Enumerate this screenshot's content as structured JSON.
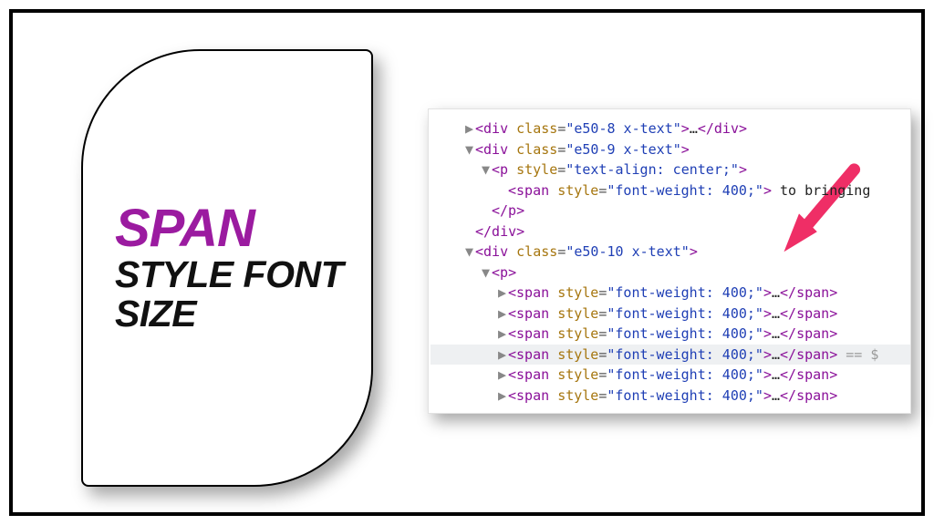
{
  "title_card": {
    "line1": "SPAN",
    "line2": "STYLE FONT",
    "line3": "SIZE"
  },
  "devtools": {
    "rows": [
      {
        "indent": 1,
        "tri": "▶",
        "open": "div",
        "attrs": [
          {
            "name": "class",
            "value": "e50-8 x-text"
          }
        ],
        "inner": "…",
        "close": "div"
      },
      {
        "indent": 1,
        "tri": "▼",
        "open": "div",
        "attrs": [
          {
            "name": "class",
            "value": "e50-9 x-text"
          }
        ]
      },
      {
        "indent": 2,
        "tri": "▼",
        "open": "p",
        "attrs": [
          {
            "name": "style",
            "value": "text-align: center;"
          }
        ]
      },
      {
        "indent": 3,
        "tri": "",
        "open": "span",
        "attrs": [
          {
            "name": "style",
            "value": "font-weight: 400;"
          }
        ],
        "trail_text": " to bringing"
      },
      {
        "indent": 2,
        "tri": "",
        "close_only": "p"
      },
      {
        "indent": 1,
        "tri": "",
        "close_only": "div"
      },
      {
        "indent": 1,
        "tri": "▼",
        "open": "div",
        "attrs": [
          {
            "name": "class",
            "value": "e50-10 x-text"
          }
        ]
      },
      {
        "indent": 2,
        "tri": "▼",
        "open": "p"
      },
      {
        "indent": 3,
        "tri": "▶",
        "open": "span",
        "attrs": [
          {
            "name": "style",
            "value": "font-weight: 400;"
          }
        ],
        "inner": "…",
        "close": "span"
      },
      {
        "indent": 3,
        "tri": "▶",
        "open": "span",
        "attrs": [
          {
            "name": "style",
            "value": "font-weight: 400;"
          }
        ],
        "inner": "…",
        "close": "span"
      },
      {
        "indent": 3,
        "tri": "▶",
        "open": "span",
        "attrs": [
          {
            "name": "style",
            "value": "font-weight: 400;"
          }
        ],
        "inner": "…",
        "close": "span"
      },
      {
        "indent": 3,
        "tri": "▶",
        "open": "span",
        "attrs": [
          {
            "name": "style",
            "value": "font-weight: 400;"
          }
        ],
        "inner": "…",
        "close": "span",
        "highlight": true,
        "eqeq": " == $"
      },
      {
        "indent": 3,
        "tri": "▶",
        "open": "span",
        "attrs": [
          {
            "name": "style",
            "value": "font-weight: 400;"
          }
        ],
        "inner": "…",
        "close": "span"
      },
      {
        "indent": 3,
        "tri": "▶",
        "open": "span",
        "attrs": [
          {
            "name": "style",
            "value": "font-weight: 400;"
          }
        ],
        "inner": "…",
        "close": "span"
      }
    ]
  },
  "arrow": {
    "color": "#ef2e66"
  }
}
